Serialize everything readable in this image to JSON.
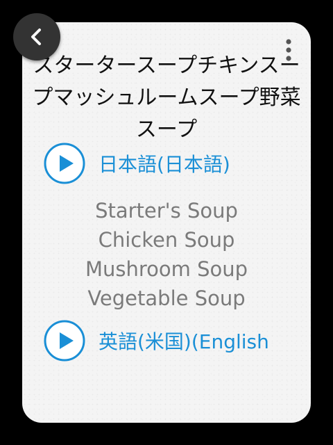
{
  "navigation": {
    "back_icon": "chevron-left-icon",
    "menu_icon": "more-vertical-icon"
  },
  "phrase": {
    "title": "スタータースープチキンスープマッシュルームスープ野菜スープ"
  },
  "languages": [
    {
      "label": "日本語(日本語)",
      "icon": "play-icon"
    },
    {
      "label": "英語(米国)(English",
      "icon": "play-icon"
    }
  ],
  "translation": {
    "lines": [
      "Starter's Soup",
      "Chicken Soup",
      "Mushroom Soup",
      "Vegetable Soup"
    ]
  },
  "colors": {
    "accent": "#1a8fd6",
    "title": "#111111",
    "translation": "#7a7a7a",
    "card": "#f4f4f4",
    "back_button": "#333333"
  }
}
